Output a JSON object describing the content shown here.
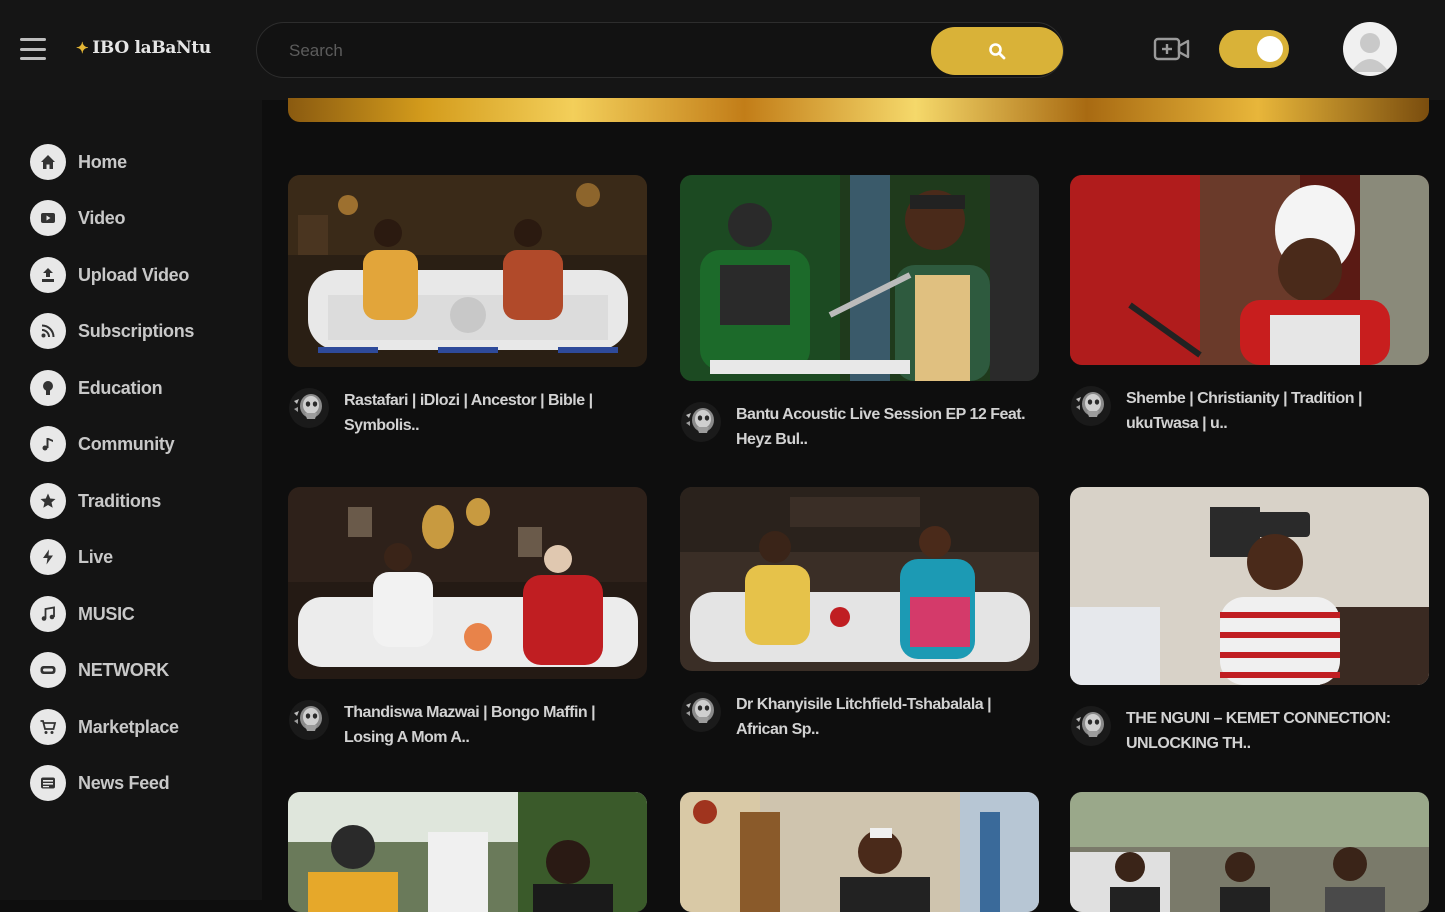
{
  "header": {
    "logo_text": "IBO laBaNtu",
    "search_placeholder": "Search",
    "accent_color": "#d9b238"
  },
  "sidebar": {
    "items": [
      {
        "label": "Home",
        "icon": "home-icon"
      },
      {
        "label": "Video",
        "icon": "video-icon"
      },
      {
        "label": "Upload Video",
        "icon": "upload-icon"
      },
      {
        "label": "Subscriptions",
        "icon": "rss-icon"
      },
      {
        "label": "Education",
        "icon": "lightbulb-icon"
      },
      {
        "label": "Community",
        "icon": "music-note-icon"
      },
      {
        "label": "Traditions",
        "icon": "star-icon"
      },
      {
        "label": "Live",
        "icon": "lightning-icon"
      },
      {
        "label": "MUSIC",
        "icon": "music-icon"
      },
      {
        "label": "NETWORK",
        "icon": "network-icon"
      },
      {
        "label": "Marketplace",
        "icon": "cart-icon"
      },
      {
        "label": "News Feed",
        "icon": "newsfeed-icon"
      }
    ]
  },
  "videos": [
    {
      "title_line1": "Rastafari | iDlozi | Ancestor | Bible |",
      "title_line2": "Symbolis.."
    },
    {
      "title_line1": "Bantu Acoustic Live Session EP 12 Feat.",
      "title_line2": "Heyz Bul.."
    },
    {
      "title_line1": "Shembe | Christianity | Tradition |",
      "title_line2": "ukuTwasa | u.."
    },
    {
      "title_line1": "Thandiswa Mazwai | Bongo Maffin |",
      "title_line2": "Losing A Mom A.."
    },
    {
      "title_line1": "Dr Khanyisile Litchfield-Tshabalala |",
      "title_line2": "African Sp.."
    },
    {
      "title_line1": "THE NGUNI – KEMET CONNECTION:",
      "title_line2": "UNLOCKING TH.."
    },
    {
      "title_line1": "",
      "title_line2": ""
    },
    {
      "title_line1": "",
      "title_line2": ""
    },
    {
      "title_line1": "",
      "title_line2": ""
    }
  ]
}
